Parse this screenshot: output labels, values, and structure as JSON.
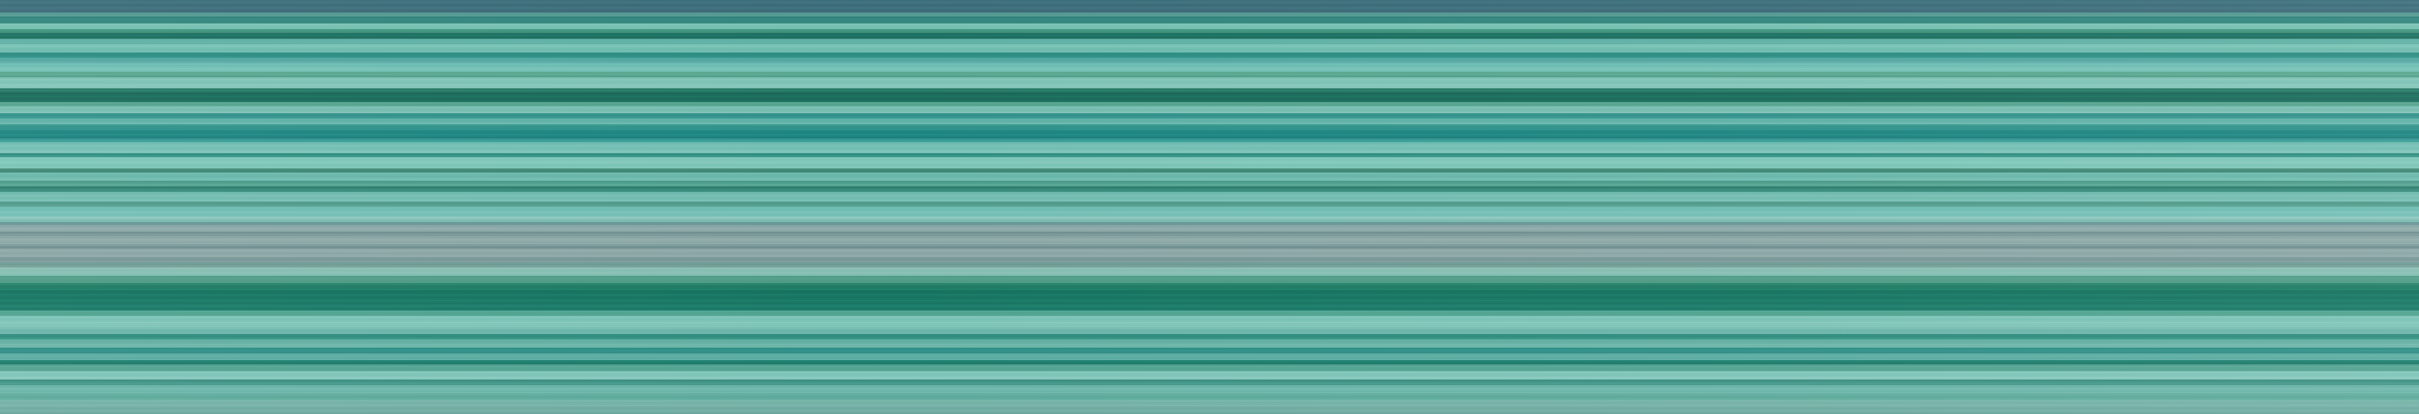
{
  "image": {
    "subject": "horizontal-stripes",
    "palette": {
      "slate_blue": "#3d6f7b",
      "teal": "#2a8f8a",
      "deep_green": "#1b6b5b",
      "mint": "#7cc3b5",
      "grey_band": "#8aa8a8"
    }
  }
}
